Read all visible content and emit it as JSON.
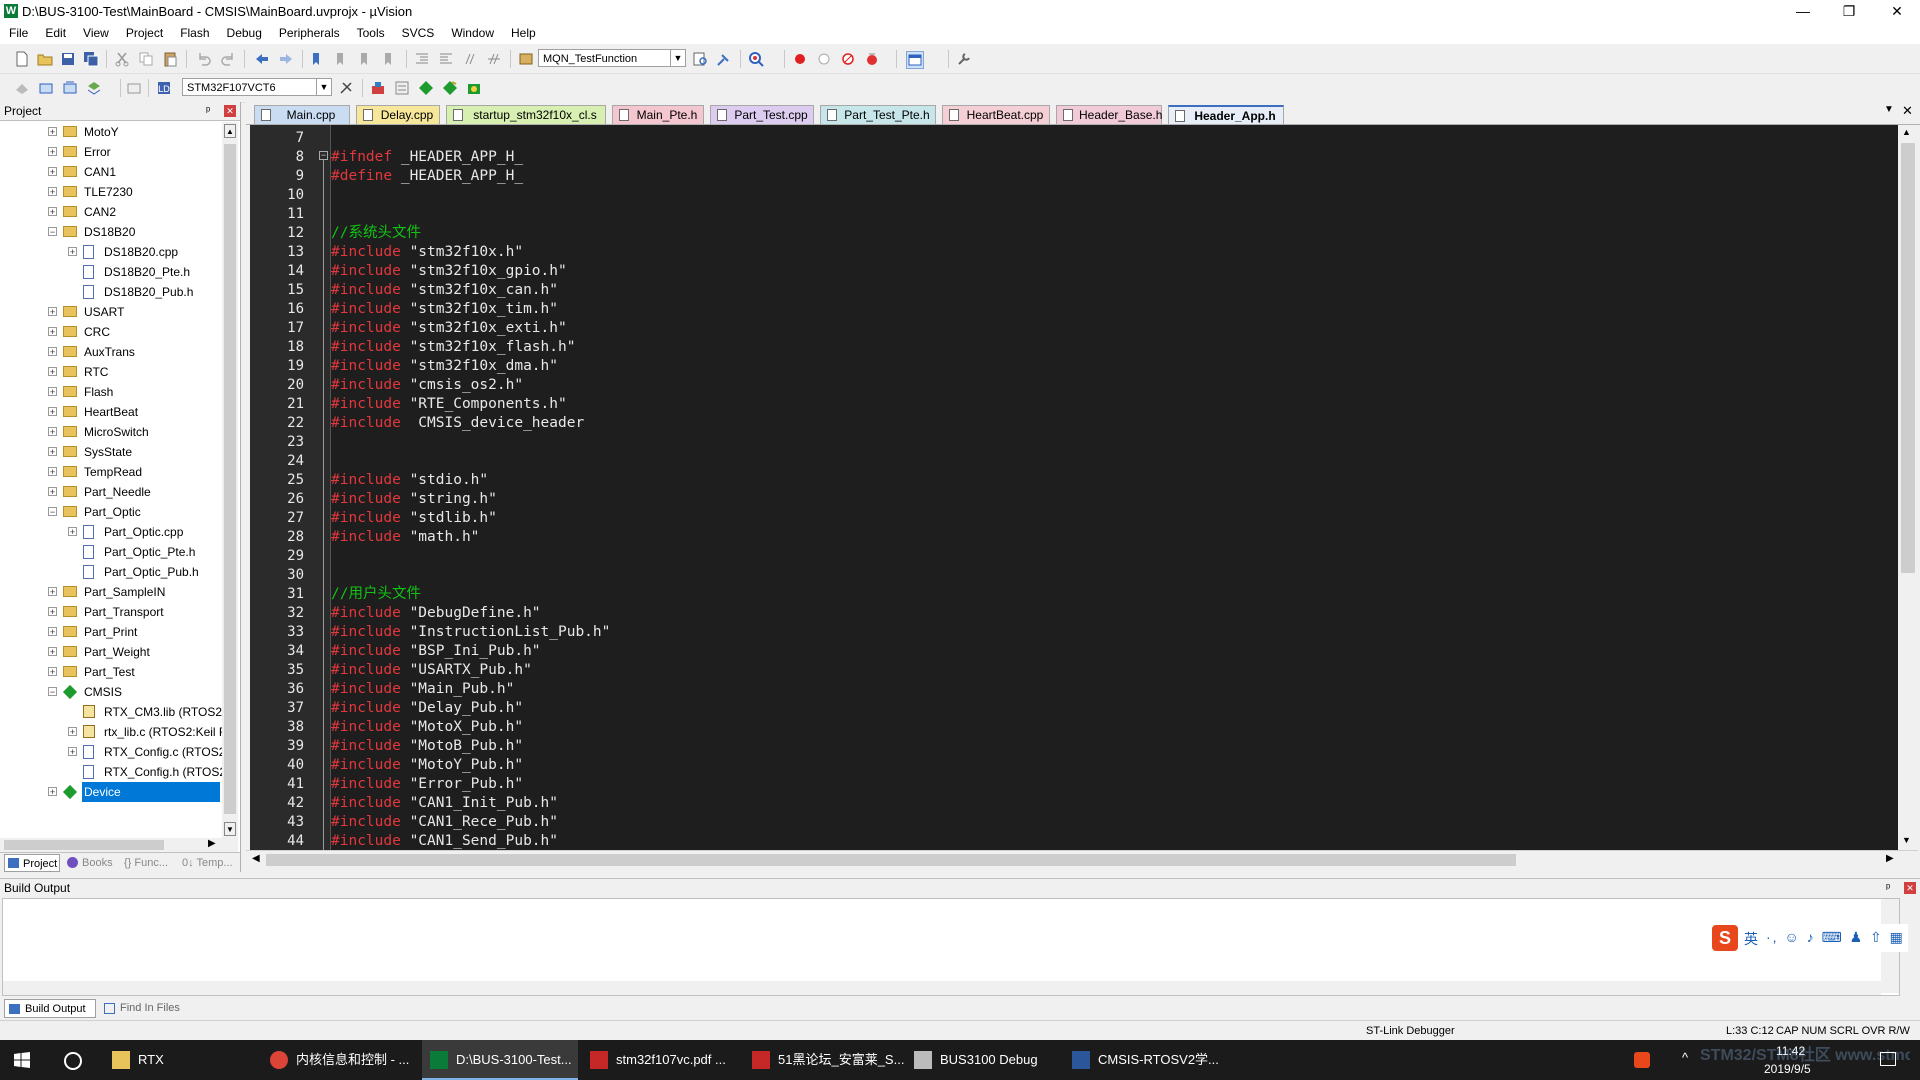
{
  "window": {
    "title": "D:\\BUS-3100-Test\\MainBoard - CMSIS\\MainBoard.uvprojx - µVision",
    "app_icon": "W",
    "controls": [
      "—",
      "❐",
      "✕"
    ]
  },
  "menu": [
    "File",
    "Edit",
    "View",
    "Project",
    "Flash",
    "Debug",
    "Peripherals",
    "Tools",
    "SVCS",
    "Window",
    "Help"
  ],
  "toolbar1": {
    "function_combo": "MQN_TestFunction"
  },
  "toolbar2": {
    "target_combo": "STM32F107VCT6"
  },
  "project_panel": {
    "title": "Project",
    "pin": "ᵖ",
    "close": "✕",
    "tree": [
      {
        "label": "MotoY",
        "type": "folder",
        "level": 1,
        "expander": "+"
      },
      {
        "label": "Error",
        "type": "folder",
        "level": 1,
        "expander": "+"
      },
      {
        "label": "CAN1",
        "type": "folder",
        "level": 1,
        "expander": "+"
      },
      {
        "label": "TLE7230",
        "type": "folder",
        "level": 1,
        "expander": "+"
      },
      {
        "label": "CAN2",
        "type": "folder",
        "level": 1,
        "expander": "+"
      },
      {
        "label": "DS18B20",
        "type": "folder",
        "level": 1,
        "expander": "−"
      },
      {
        "label": "DS18B20.cpp",
        "type": "file",
        "level": 2,
        "expander": "+"
      },
      {
        "label": "DS18B20_Pte.h",
        "type": "file",
        "level": 2,
        "expander": ""
      },
      {
        "label": "DS18B20_Pub.h",
        "type": "file",
        "level": 2,
        "expander": ""
      },
      {
        "label": "USART",
        "type": "folder",
        "level": 1,
        "expander": "+"
      },
      {
        "label": "CRC",
        "type": "folder",
        "level": 1,
        "expander": "+"
      },
      {
        "label": "AuxTrans",
        "type": "folder",
        "level": 1,
        "expander": "+"
      },
      {
        "label": "RTC",
        "type": "folder",
        "level": 1,
        "expander": "+"
      },
      {
        "label": "Flash",
        "type": "folder",
        "level": 1,
        "expander": "+"
      },
      {
        "label": "HeartBeat",
        "type": "folder",
        "level": 1,
        "expander": "+"
      },
      {
        "label": "MicroSwitch",
        "type": "folder",
        "level": 1,
        "expander": "+"
      },
      {
        "label": "SysState",
        "type": "folder",
        "level": 1,
        "expander": "+"
      },
      {
        "label": "TempRead",
        "type": "folder",
        "level": 1,
        "expander": "+"
      },
      {
        "label": "Part_Needle",
        "type": "folder",
        "level": 1,
        "expander": "+"
      },
      {
        "label": "Part_Optic",
        "type": "folder",
        "level": 1,
        "expander": "−"
      },
      {
        "label": "Part_Optic.cpp",
        "type": "file",
        "level": 2,
        "expander": "+"
      },
      {
        "label": "Part_Optic_Pte.h",
        "type": "file",
        "level": 2,
        "expander": ""
      },
      {
        "label": "Part_Optic_Pub.h",
        "type": "file",
        "level": 2,
        "expander": ""
      },
      {
        "label": "Part_SampleIN",
        "type": "folder",
        "level": 1,
        "expander": "+"
      },
      {
        "label": "Part_Transport",
        "type": "folder",
        "level": 1,
        "expander": "+"
      },
      {
        "label": "Part_Print",
        "type": "folder",
        "level": 1,
        "expander": "+"
      },
      {
        "label": "Part_Weight",
        "type": "folder",
        "level": 1,
        "expander": "+"
      },
      {
        "label": "Part_Test",
        "type": "folder",
        "level": 1,
        "expander": "+"
      },
      {
        "label": "CMSIS",
        "type": "diamond",
        "level": 1,
        "expander": "−"
      },
      {
        "label": "RTX_CM3.lib (RTOS2:K",
        "type": "lib",
        "level": 2,
        "expander": ""
      },
      {
        "label": "rtx_lib.c (RTOS2:Keil R",
        "type": "lib",
        "level": 2,
        "expander": "+"
      },
      {
        "label": "RTX_Config.c (RTOS2:",
        "type": "file",
        "level": 2,
        "expander": "+"
      },
      {
        "label": "RTX_Config.h (RTOS2:",
        "type": "file",
        "level": 2,
        "expander": ""
      },
      {
        "label": "Device",
        "type": "diamond",
        "level": 1,
        "expander": "+",
        "selected": true
      }
    ],
    "bottom_tabs": [
      "Project",
      "Books",
      "{} Func...",
      "0↓ Temp..."
    ]
  },
  "tabs": [
    {
      "label": "Main.cpp",
      "color": "#c9dcf2"
    },
    {
      "label": "Delay.cpp",
      "color": "#f6e79a"
    },
    {
      "label": "startup_stm32f10x_cl.s",
      "color": "#d8efb2"
    },
    {
      "label": "Main_Pte.h",
      "color": "#f4c6cf"
    },
    {
      "label": "Part_Test.cpp",
      "color": "#dccdf0"
    },
    {
      "label": "Part_Test_Pte.h",
      "color": "#c6e6ea"
    },
    {
      "label": "HeartBeat.cpp",
      "color": "#f4cfd6"
    },
    {
      "label": "Header_Base.h",
      "color": "#f2cbd8"
    },
    {
      "label": "Header_App.h",
      "color": "#e8eef8",
      "active": true
    }
  ],
  "tab_controls": {
    "dropdown": "▼",
    "close": "✕"
  },
  "code_lines": [
    {
      "n": "7",
      "parts": []
    },
    {
      "n": "8",
      "parts": [
        {
          "c": "kw",
          "t": "#ifndef "
        },
        {
          "c": "plain",
          "t": "_HEADER_APP_H_"
        }
      ]
    },
    {
      "n": "9",
      "parts": [
        {
          "c": "kw",
          "t": "#define "
        },
        {
          "c": "plain",
          "t": "_HEADER_APP_H_"
        }
      ]
    },
    {
      "n": "10",
      "parts": []
    },
    {
      "n": "11",
      "parts": []
    },
    {
      "n": "12",
      "parts": [
        {
          "c": "cm",
          "t": "//系统头文件"
        }
      ]
    },
    {
      "n": "13",
      "parts": [
        {
          "c": "kw",
          "t": "#include "
        },
        {
          "c": "str",
          "t": "\"stm32f10x.h\""
        }
      ]
    },
    {
      "n": "14",
      "parts": [
        {
          "c": "kw",
          "t": "#include "
        },
        {
          "c": "str",
          "t": "\"stm32f10x_gpio.h\""
        }
      ]
    },
    {
      "n": "15",
      "parts": [
        {
          "c": "kw",
          "t": "#include "
        },
        {
          "c": "str",
          "t": "\"stm32f10x_can.h\""
        }
      ]
    },
    {
      "n": "16",
      "parts": [
        {
          "c": "kw",
          "t": "#include "
        },
        {
          "c": "str",
          "t": "\"stm32f10x_tim.h\""
        }
      ]
    },
    {
      "n": "17",
      "parts": [
        {
          "c": "kw",
          "t": "#include "
        },
        {
          "c": "str",
          "t": "\"stm32f10x_exti.h\""
        }
      ]
    },
    {
      "n": "18",
      "parts": [
        {
          "c": "kw",
          "t": "#include "
        },
        {
          "c": "str",
          "t": "\"stm32f10x_flash.h\""
        }
      ]
    },
    {
      "n": "19",
      "parts": [
        {
          "c": "kw",
          "t": "#include "
        },
        {
          "c": "str",
          "t": "\"stm32f10x_dma.h\""
        }
      ]
    },
    {
      "n": "20",
      "parts": [
        {
          "c": "kw",
          "t": "#include "
        },
        {
          "c": "str",
          "t": "\"cmsis_os2.h\""
        }
      ]
    },
    {
      "n": "21",
      "parts": [
        {
          "c": "kw",
          "t": "#include "
        },
        {
          "c": "str",
          "t": "\"RTE_Components.h\""
        }
      ]
    },
    {
      "n": "22",
      "parts": [
        {
          "c": "kw",
          "t": "#include "
        },
        {
          "c": "plain",
          "t": " CMSIS_device_header"
        }
      ]
    },
    {
      "n": "23",
      "parts": []
    },
    {
      "n": "24",
      "parts": []
    },
    {
      "n": "25",
      "parts": [
        {
          "c": "kw",
          "t": "#include "
        },
        {
          "c": "str",
          "t": "\"stdio.h\""
        }
      ]
    },
    {
      "n": "26",
      "parts": [
        {
          "c": "kw",
          "t": "#include "
        },
        {
          "c": "str",
          "t": "\"string.h\""
        }
      ]
    },
    {
      "n": "27",
      "parts": [
        {
          "c": "kw",
          "t": "#include "
        },
        {
          "c": "str",
          "t": "\"stdlib.h\""
        }
      ]
    },
    {
      "n": "28",
      "parts": [
        {
          "c": "kw",
          "t": "#include "
        },
        {
          "c": "str",
          "t": "\"math.h\""
        }
      ]
    },
    {
      "n": "29",
      "parts": []
    },
    {
      "n": "30",
      "parts": []
    },
    {
      "n": "31",
      "parts": [
        {
          "c": "cm",
          "t": "//用户头文件"
        }
      ]
    },
    {
      "n": "32",
      "parts": [
        {
          "c": "kw",
          "t": "#include "
        },
        {
          "c": "str",
          "t": "\"DebugDefine.h\""
        }
      ]
    },
    {
      "n": "33",
      "parts": [
        {
          "c": "kw",
          "t": "#include "
        },
        {
          "c": "str",
          "t": "\"InstructionList_Pub.h\""
        }
      ]
    },
    {
      "n": "34",
      "parts": [
        {
          "c": "kw",
          "t": "#include "
        },
        {
          "c": "str",
          "t": "\"BSP_Ini_Pub.h\""
        }
      ]
    },
    {
      "n": "35",
      "parts": [
        {
          "c": "kw",
          "t": "#include "
        },
        {
          "c": "str",
          "t": "\"USARTX_Pub.h\""
        }
      ]
    },
    {
      "n": "36",
      "parts": [
        {
          "c": "kw",
          "t": "#include "
        },
        {
          "c": "str",
          "t": "\"Main_Pub.h\""
        }
      ]
    },
    {
      "n": "37",
      "parts": [
        {
          "c": "kw",
          "t": "#include "
        },
        {
          "c": "str",
          "t": "\"Delay_Pub.h\""
        }
      ]
    },
    {
      "n": "38",
      "parts": [
        {
          "c": "kw",
          "t": "#include "
        },
        {
          "c": "str",
          "t": "\"MotoX_Pub.h\""
        }
      ]
    },
    {
      "n": "39",
      "parts": [
        {
          "c": "kw",
          "t": "#include "
        },
        {
          "c": "str",
          "t": "\"MotoB_Pub.h\""
        }
      ]
    },
    {
      "n": "40",
      "parts": [
        {
          "c": "kw",
          "t": "#include "
        },
        {
          "c": "str",
          "t": "\"MotoY_Pub.h\""
        }
      ]
    },
    {
      "n": "41",
      "parts": [
        {
          "c": "kw",
          "t": "#include "
        },
        {
          "c": "str",
          "t": "\"Error_Pub.h\""
        }
      ]
    },
    {
      "n": "42",
      "parts": [
        {
          "c": "kw",
          "t": "#include "
        },
        {
          "c": "str",
          "t": "\"CAN1_Init_Pub.h\""
        }
      ]
    },
    {
      "n": "43",
      "parts": [
        {
          "c": "kw",
          "t": "#include "
        },
        {
          "c": "str",
          "t": "\"CAN1_Rece_Pub.h\""
        }
      ]
    },
    {
      "n": "44",
      "parts": [
        {
          "c": "kw",
          "t": "#include "
        },
        {
          "c": "str",
          "t": "\"CAN1_Send_Pub.h\""
        }
      ]
    }
  ],
  "build_output": {
    "title": "Build Output",
    "tabs": [
      "Build Output",
      "Find In Files"
    ]
  },
  "ime": {
    "logo": "S",
    "lang": "英",
    "extras": "·, ☺ ♪ ⌨ ♟ ⇧ ▦"
  },
  "status": {
    "debugger": "ST-Link Debugger",
    "position": "L:33 C:12",
    "indicators": "CAP  NUM  SCRL  OVR  R/W"
  },
  "taskbar": {
    "items": [
      {
        "label": "RTX",
        "icon": "folder-icon"
      },
      {
        "label": "内核信息和控制 - ...",
        "icon": "chrome-icon"
      },
      {
        "label": "D:\\BUS-3100-Test...",
        "icon": "keil-icon",
        "active": true
      },
      {
        "label": "stm32f107vc.pdf ...",
        "icon": "pdf-icon"
      },
      {
        "label": "51黑论坛_安富莱_S...",
        "icon": "pdf-icon"
      },
      {
        "label": "BUS3100 Debug",
        "icon": "gear-icon"
      },
      {
        "label": "CMSIS-RTOSV2学...",
        "icon": "word-icon"
      }
    ],
    "time": "11:42",
    "date": "2019/9/5",
    "watermark": "STM32/STM8社区 www.stmcu.org.cn"
  },
  "colors": {
    "editor_bg": "#1e1e1e",
    "keyword": "#e2383d",
    "comment": "#12c412",
    "text": "#e8e8e8",
    "selection": "#0078d7"
  }
}
